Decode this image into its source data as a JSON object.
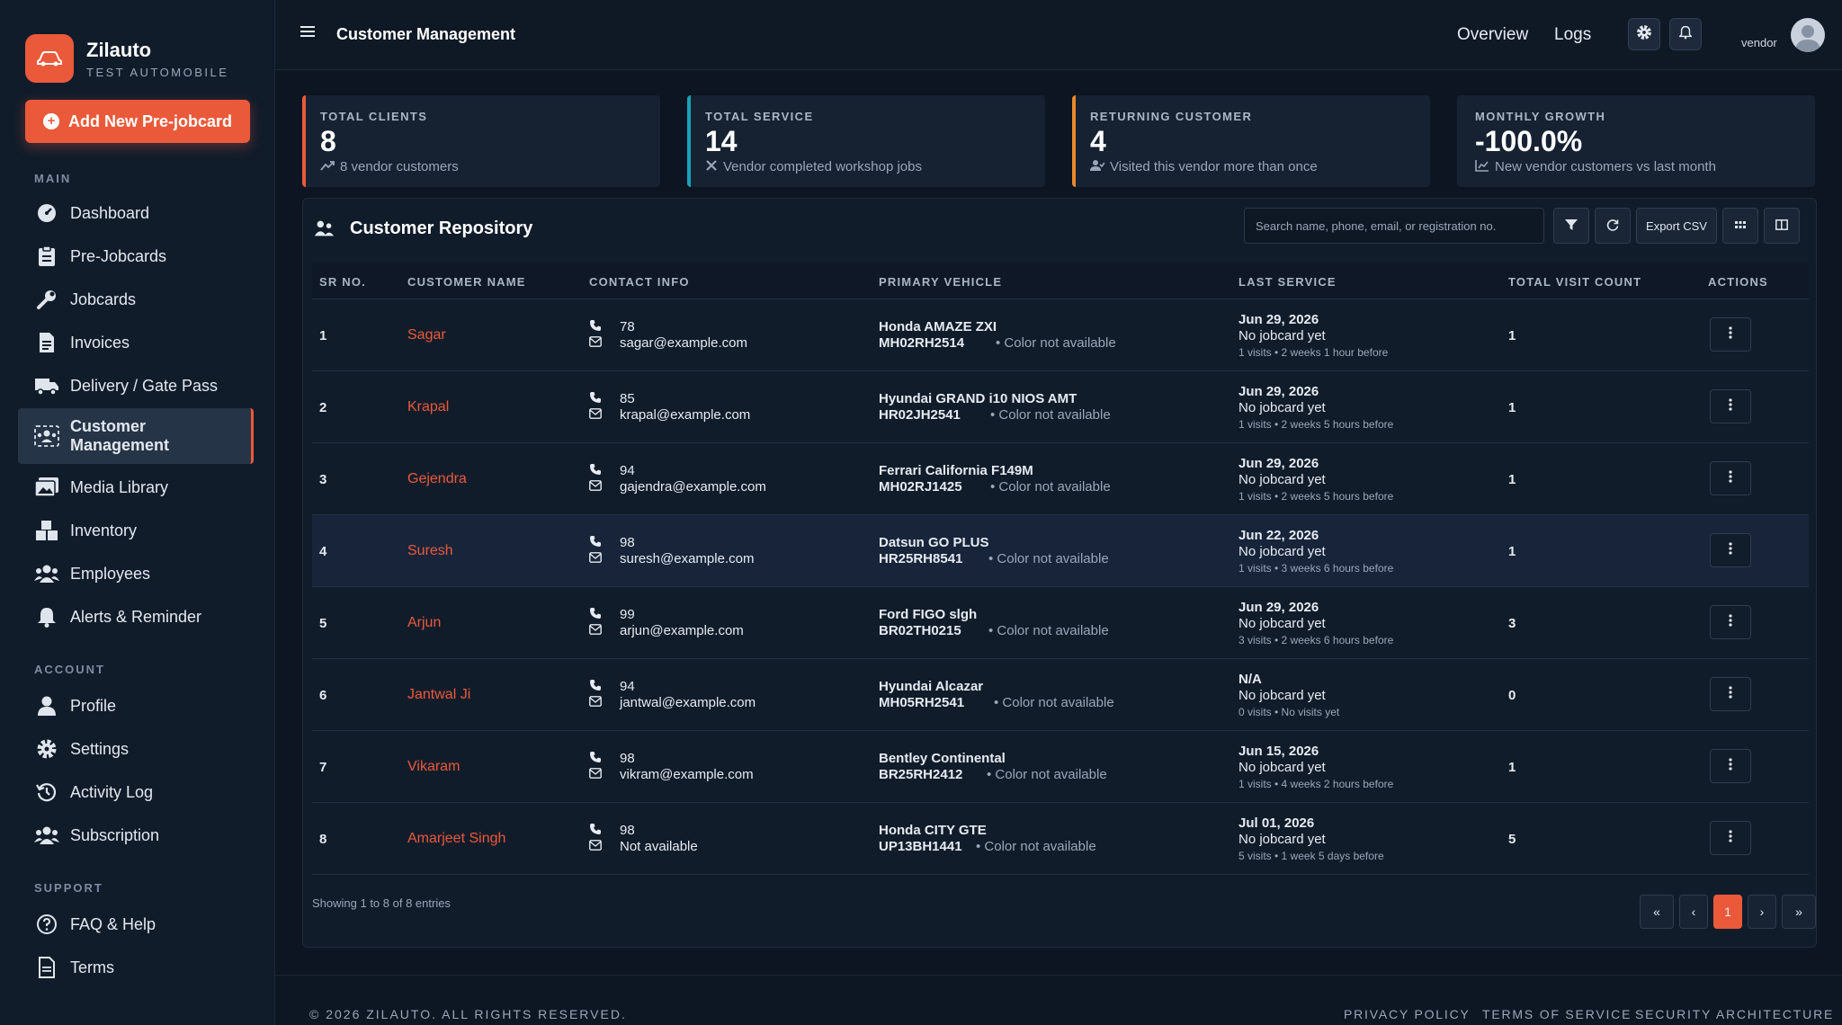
{
  "brand": {
    "name": "Zilauto",
    "subtitle": "TEST AUTOMOBILE"
  },
  "sidebar": {
    "add_button": "Add New Pre-jobcard",
    "sections": {
      "main": "MAIN",
      "account": "ACCOUNT",
      "support": "SUPPORT"
    },
    "main_items": [
      {
        "label": "Dashboard",
        "icon": "dashboard-icon"
      },
      {
        "label": "Pre-Jobcards",
        "icon": "clipboard-icon"
      },
      {
        "label": "Jobcards",
        "icon": "wrench-icon"
      },
      {
        "label": "Invoices",
        "icon": "invoice-icon"
      },
      {
        "label": "Delivery / Gate Pass",
        "icon": "truck-icon"
      },
      {
        "label": "Customer Management",
        "icon": "users-icon",
        "active": true
      },
      {
        "label": "Media Library",
        "icon": "images-icon"
      },
      {
        "label": "Inventory",
        "icon": "boxes-icon"
      },
      {
        "label": "Employees",
        "icon": "people-icon"
      },
      {
        "label": "Alerts & Reminder",
        "icon": "bell-icon"
      }
    ],
    "account_items": [
      {
        "label": "Profile",
        "icon": "user-icon"
      },
      {
        "label": "Settings",
        "icon": "gear-icon"
      },
      {
        "label": "Activity Log",
        "icon": "history-icon"
      },
      {
        "label": "Subscription",
        "icon": "people-icon"
      }
    ],
    "support_items": [
      {
        "label": "FAQ & Help",
        "icon": "question-icon"
      },
      {
        "label": "Terms",
        "icon": "document-icon"
      }
    ]
  },
  "topbar": {
    "title": "Customer Management",
    "links": [
      "Overview",
      "Logs"
    ],
    "user": "vendor"
  },
  "stats": [
    {
      "label": "TOTAL CLIENTS",
      "value": "8",
      "note": "8 vendor customers",
      "accent": "#ea5a3a"
    },
    {
      "label": "TOTAL SERVICE",
      "value": "14",
      "note": "Vendor completed workshop jobs",
      "accent": "#1aa3b8"
    },
    {
      "label": "RETURNING CUSTOMER",
      "value": "4",
      "note": "Visited this vendor more than once",
      "accent": "#e8892a"
    },
    {
      "label": "MONTHLY GROWTH",
      "value": "-100.0%",
      "note": "New vendor customers vs last month",
      "accent": "#162232"
    }
  ],
  "repository": {
    "title": "Customer Repository",
    "search_placeholder": "Search name, phone, email, or registration no.",
    "export_label": "Export CSV",
    "columns": [
      "SR NO.",
      "CUSTOMER NAME",
      "CONTACT INFO",
      "PRIMARY VEHICLE",
      "LAST SERVICE",
      "TOTAL VISIT COUNT",
      "ACTIONS"
    ],
    "rows": [
      {
        "sr": "1",
        "name": "Sagar",
        "phone": "78",
        "email": "sagar@example.com",
        "vehicle": "Honda AMAZE ZXI",
        "reg": "MH02RH2514",
        "color": "• Color not available",
        "date": "Jun 29, 2026",
        "job": "No jobcard yet",
        "meta": "1 visits • 2 weeks 1 hour before",
        "visits": "1"
      },
      {
        "sr": "2",
        "name": "Krapal",
        "phone": "85",
        "email": "krapal@example.com",
        "vehicle": "Hyundai GRAND i10 NIOS AMT",
        "reg": "HR02JH2541",
        "color": "• Color not available",
        "date": "Jun 29, 2026",
        "job": "No jobcard yet",
        "meta": "1 visits • 2 weeks 5 hours before",
        "visits": "1"
      },
      {
        "sr": "3",
        "name": "Gejendra",
        "phone": "94",
        "email": "gajendra@example.com",
        "vehicle": "Ferrari California F149M",
        "reg": "MH02RJ1425",
        "color": "• Color not available",
        "date": "Jun 29, 2026",
        "job": "No jobcard yet",
        "meta": "1 visits • 2 weeks 5 hours before",
        "visits": "1"
      },
      {
        "sr": "4",
        "name": "Suresh",
        "phone": "98",
        "email": "suresh@example.com",
        "vehicle": "Datsun GO PLUS",
        "reg": "HR25RH8541",
        "color": "• Color not available",
        "date": "Jun 22, 2026",
        "job": "No jobcard yet",
        "meta": "1 visits • 3 weeks 6 hours before",
        "visits": "1"
      },
      {
        "sr": "5",
        "name": "Arjun",
        "phone": "99",
        "email": "arjun@example.com",
        "vehicle": "Ford FIGO slgh",
        "reg": "BR02TH0215",
        "color": "• Color not available",
        "date": "Jun 29, 2026",
        "job": "No jobcard yet",
        "meta": "3 visits • 2 weeks 6 hours before",
        "visits": "3"
      },
      {
        "sr": "6",
        "name": "Jantwal Ji",
        "phone": "94",
        "email": "jantwal@example.com",
        "vehicle": "Hyundai Alcazar",
        "reg": "MH05RH2541",
        "color": "• Color not available",
        "date": "N/A",
        "job": "No jobcard yet",
        "meta": "0 visits • No visits yet",
        "visits": "0"
      },
      {
        "sr": "7",
        "name": "Vikaram",
        "phone": "98",
        "email": "vikram@example.com",
        "vehicle": "Bentley Continental",
        "reg": "BR25RH2412",
        "color": "• Color not available",
        "date": "Jun 15, 2026",
        "job": "No jobcard yet",
        "meta": "1 visits • 4 weeks 2 hours before",
        "visits": "1"
      },
      {
        "sr": "8",
        "name": "Amarjeet Singh",
        "phone": "98",
        "email": "Not available",
        "vehicle": "Honda CITY GTE",
        "reg": "UP13BH1441",
        "color": "• Color not available",
        "date": "Jul 01, 2026",
        "job": "No jobcard yet",
        "meta": "5 visits • 1 week 5 days before",
        "visits": "5"
      }
    ],
    "showing": "Showing 1 to 8 of 8 entries",
    "current_page": "1"
  },
  "footer": {
    "copyright": "© 2026 ZILAUTO. ALL RIGHTS RESERVED.",
    "links": [
      "PRIVACY POLICY",
      "TERMS OF SERVICE",
      "SECURITY ARCHITECTURE"
    ]
  }
}
